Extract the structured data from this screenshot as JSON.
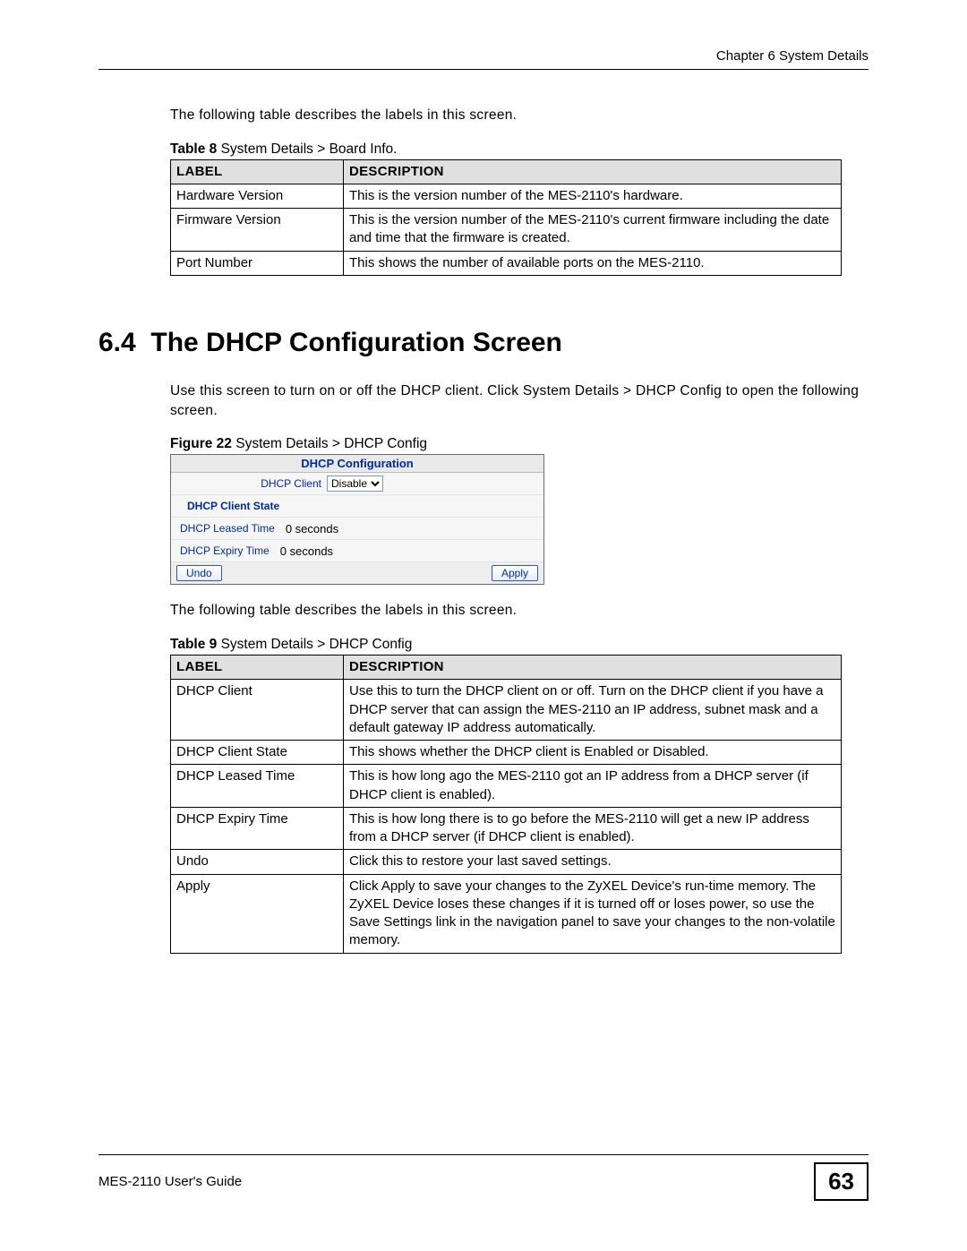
{
  "header": {
    "chapter": "Chapter 6 System Details"
  },
  "intro1": "The following table describes the labels in this screen.",
  "table8": {
    "caption_bold": "Table 8",
    "caption_rest": "   System Details > Board Info.",
    "head_label": "LABEL",
    "head_desc": "DESCRIPTION",
    "rows": [
      {
        "label": "Hardware Version",
        "desc": "This is the version number of the MES-2110's hardware."
      },
      {
        "label": "Firmware Version",
        "desc": "This is the version number of the MES-2110's current firmware including the date and time that the firmware is created."
      },
      {
        "label": "Port Number",
        "desc": "This shows the number of available ports on the MES-2110."
      }
    ]
  },
  "section": {
    "number": "6.4",
    "title": "The DHCP Configuration Screen",
    "intro": "Use this screen to turn on or off the DHCP client. Click System Details > DHCP Config to open the following screen."
  },
  "figure22": {
    "caption_bold": "Figure 22",
    "caption_rest": "   System Details > DHCP Config",
    "panel_title": "DHCP Configuration",
    "dhcp_client_label": "DHCP Client",
    "dhcp_client_value": "Disable",
    "dhcp_client_state_label": "DHCP Client State",
    "dhcp_leased_label": "DHCP Leased Time",
    "dhcp_leased_value": "0 seconds",
    "dhcp_expiry_label": "DHCP Expiry Time",
    "dhcp_expiry_value": "0 seconds",
    "undo_btn": "Undo",
    "apply_btn": "Apply"
  },
  "intro2": "The following table describes the labels in this screen.",
  "table9": {
    "caption_bold": "Table 9",
    "caption_rest": "   System Details > DHCP Config",
    "head_label": "LABEL",
    "head_desc": "DESCRIPTION",
    "rows": [
      {
        "label": "DHCP Client",
        "desc": "Use this to turn the DHCP client on or off. Turn on the DHCP client if you have a DHCP server that can assign the MES-2110 an IP address, subnet mask and a default gateway IP address automatically."
      },
      {
        "label": "DHCP Client State",
        "desc": "This shows whether the DHCP client is Enabled or Disabled."
      },
      {
        "label": "DHCP Leased Time",
        "desc": "This is how long ago the MES-2110 got an IP address from a DHCP server (if DHCP client is enabled)."
      },
      {
        "label": "DHCP Expiry Time",
        "desc": "This is how long there is to go before the MES-2110 will get a new IP address from a DHCP server (if DHCP client is enabled)."
      },
      {
        "label": "Undo",
        "desc": "Click this to restore your last saved settings."
      },
      {
        "label": "Apply",
        "desc": "Click Apply to save your changes to the ZyXEL Device's run-time memory. The ZyXEL Device loses these changes if it is turned off or loses power, so use the Save Settings link in the navigation panel to save your changes to the non-volatile memory."
      }
    ]
  },
  "footer": {
    "guide": "MES-2110 User's Guide",
    "page": "63"
  }
}
